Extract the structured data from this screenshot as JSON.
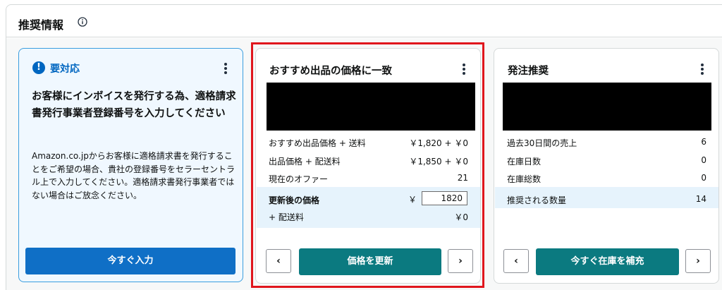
{
  "header": {
    "title": "推奨情報",
    "info_icon": "info-icon"
  },
  "alert_card": {
    "label": "要対応",
    "title": "お客様にインボイスを発行する為、適格請求書発行事業者登録番号を入力してください",
    "body": "Amazon.co.jpからお客様に適格請求書を発行することをご希望の場合、貴社の登録番号をセラーセントラル上で入力してください。適格請求書発行事業者ではない場合はご放念ください。",
    "button": "今すぐ入力"
  },
  "price_card": {
    "title": "おすすめ出品の価格に一致",
    "rows": [
      {
        "label": "おすすめ出品価格 + 送料",
        "value": "￥1,820 + ￥0"
      },
      {
        "label": "出品価格 + 配送料",
        "value": "￥1,850 + ￥0"
      },
      {
        "label": "現在のオファー",
        "value": "21"
      }
    ],
    "updated_label": "更新後の価格",
    "currency": "￥",
    "updated_value": "1820",
    "shipping_label": "+ 配送料",
    "shipping_value": "￥0",
    "button": "価格を更新",
    "prev": "‹",
    "next": "›"
  },
  "order_card": {
    "title": "発注推奨",
    "rows": [
      {
        "label": "過去30日間の売上",
        "value": "6"
      },
      {
        "label": "在庫日数",
        "value": "0"
      },
      {
        "label": "在庫総数",
        "value": "0"
      }
    ],
    "recommended_label": "推奨される数量",
    "recommended_value": "14",
    "button": "今すぐ在庫を補充",
    "prev": "‹",
    "next": "›"
  },
  "colors": {
    "accent": "#0f6fc6",
    "teal": "#0b7a80",
    "highlight": "#e0161d",
    "shade": "#e6f3fc"
  }
}
